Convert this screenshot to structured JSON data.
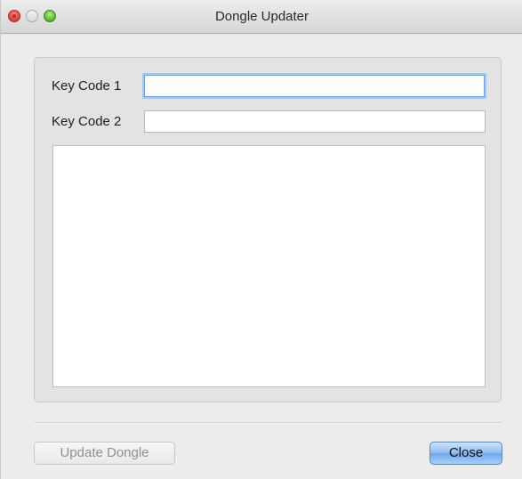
{
  "window": {
    "title": "Dongle Updater"
  },
  "form": {
    "key_code_1": {
      "label": "Key Code 1",
      "value": ""
    },
    "key_code_2": {
      "label": "Key Code 2",
      "value": ""
    },
    "output": ""
  },
  "buttons": {
    "update_label": "Update Dongle",
    "update_enabled": false,
    "close_label": "Close"
  },
  "colors": {
    "close_light": "#e9473f",
    "zoom_light": "#64c13b",
    "focus_ring": "#a9c8ee",
    "default_button": "#8bbcf2"
  }
}
